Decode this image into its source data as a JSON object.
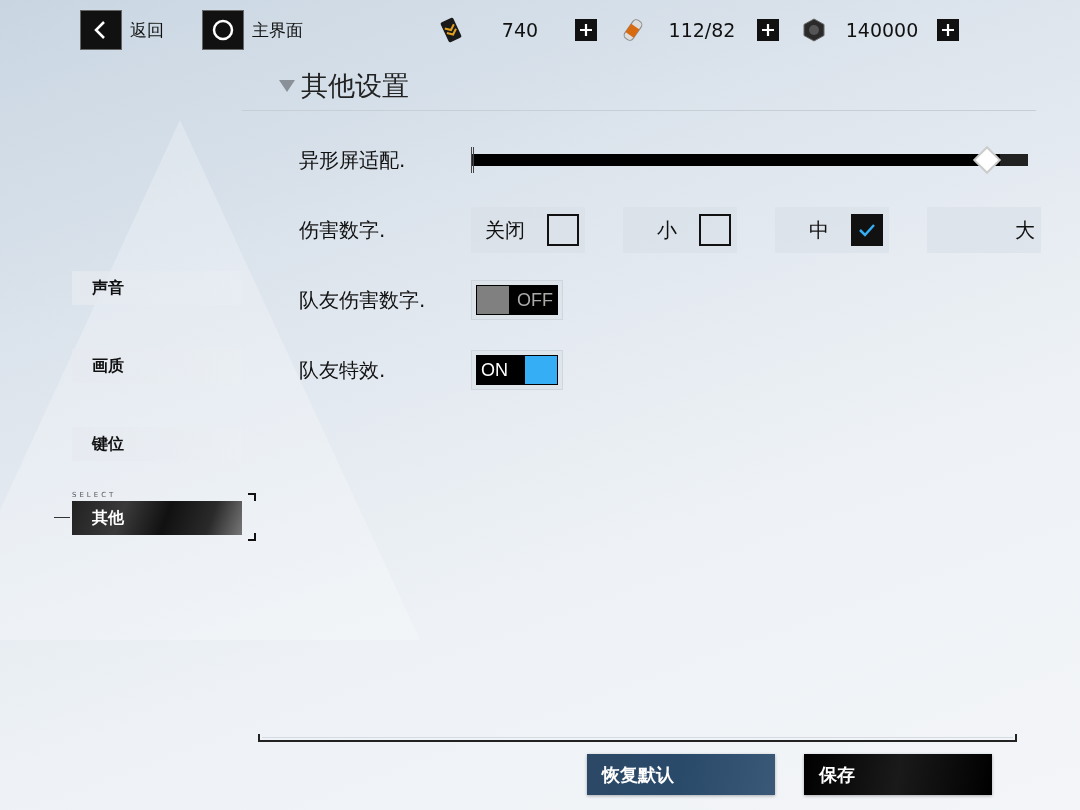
{
  "top_bar": {
    "back": {
      "label": "返回"
    },
    "home": {
      "label": "主界面"
    },
    "currencies": [
      {
        "kind": "card",
        "amount": "740"
      },
      {
        "kind": "capsule",
        "amount": "112/82"
      },
      {
        "kind": "nut",
        "amount": "140000"
      }
    ]
  },
  "sidebar": {
    "caption": "SELECT",
    "items": [
      {
        "label": "声音",
        "selected": false
      },
      {
        "label": "画质",
        "selected": false
      },
      {
        "label": "键位",
        "selected": false
      },
      {
        "label": "其他",
        "selected": true
      }
    ]
  },
  "section": {
    "title": "其他设置",
    "expanded": true
  },
  "settings": [
    {
      "kind": "slider",
      "label": "异形屏适配.",
      "level": 0.97
    },
    {
      "kind": "choice",
      "label": "伤害数字.",
      "options": [
        {
          "label": "关闭",
          "checked": false
        },
        {
          "label": "小",
          "checked": false
        },
        {
          "label": "中",
          "checked": true
        },
        {
          "label": "大"
        }
      ]
    },
    {
      "kind": "toggle",
      "label": "队友伤害数字.",
      "on": false,
      "text": "OFF"
    },
    {
      "kind": "toggle",
      "label": "队友特效.",
      "on": true,
      "text": "ON"
    }
  ],
  "buttons": [
    {
      "kind": "reset",
      "label": "恢复默认"
    },
    {
      "kind": "save",
      "label": "保存"
    }
  ]
}
